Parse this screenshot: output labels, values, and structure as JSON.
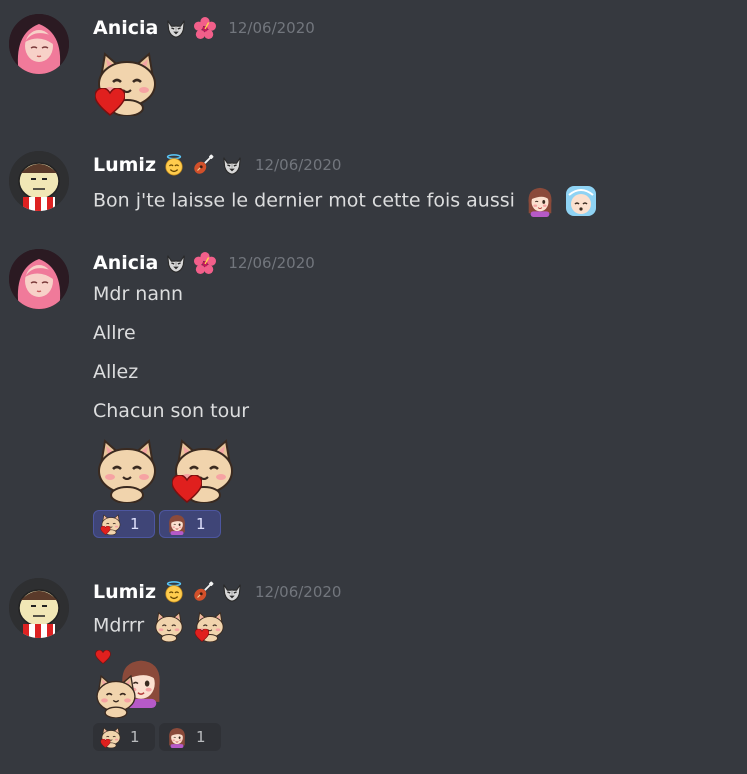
{
  "messages": [
    {
      "author": "Anicia",
      "badges": [
        "wolf-icon",
        "hibiscus-icon"
      ],
      "timestamp": "12/06/2020",
      "content_lines": [],
      "stickers": [
        "cat-heart-sticker"
      ]
    },
    {
      "author": "Lumiz",
      "badges": [
        "angel-emoji-icon",
        "guitar-icon",
        "wolf-icon"
      ],
      "timestamp": "12/06/2020",
      "content_lines": [
        "Bon j'te laisse le dernier mot cette fois aussi"
      ],
      "inline_emojis": [
        "girl-blush-emoji",
        "baby-sleep-emoji"
      ]
    },
    {
      "author": "Anicia",
      "badges": [
        "wolf-icon",
        "hibiscus-icon"
      ],
      "timestamp": "12/06/2020",
      "content_lines": [
        "Mdr nann",
        "Allre",
        "Allez",
        "Chacun son tour"
      ],
      "stickers": [
        "cat-blush-sticker",
        "cat-heart-sticker"
      ],
      "reactions": [
        {
          "emoji": "cat-heart-emoji",
          "count": "1",
          "active": true
        },
        {
          "emoji": "girl-hug-emoji",
          "count": "1",
          "active": true
        }
      ]
    },
    {
      "author": "Lumiz",
      "badges": [
        "angel-emoji-icon",
        "guitar-icon",
        "wolf-icon"
      ],
      "timestamp": "12/06/2020",
      "content_lines": [
        "Mdrrr"
      ],
      "inline_emojis": [
        "cat-shy-emoji",
        "cat-heart-emoji"
      ],
      "stickers": [
        "girl-cat-hug-sticker"
      ],
      "reactions": [
        {
          "emoji": "cat-heart-emoji",
          "count": "1",
          "active": false
        },
        {
          "emoji": "girl-hug-emoji",
          "count": "1",
          "active": false
        }
      ]
    }
  ],
  "colors": {
    "background": "#36393f",
    "username": "#ffffff",
    "text": "#dcddde",
    "timestamp": "#72767d",
    "reaction_active_bg": "#3f4577",
    "reaction_inactive_bg": "#2f3136"
  }
}
